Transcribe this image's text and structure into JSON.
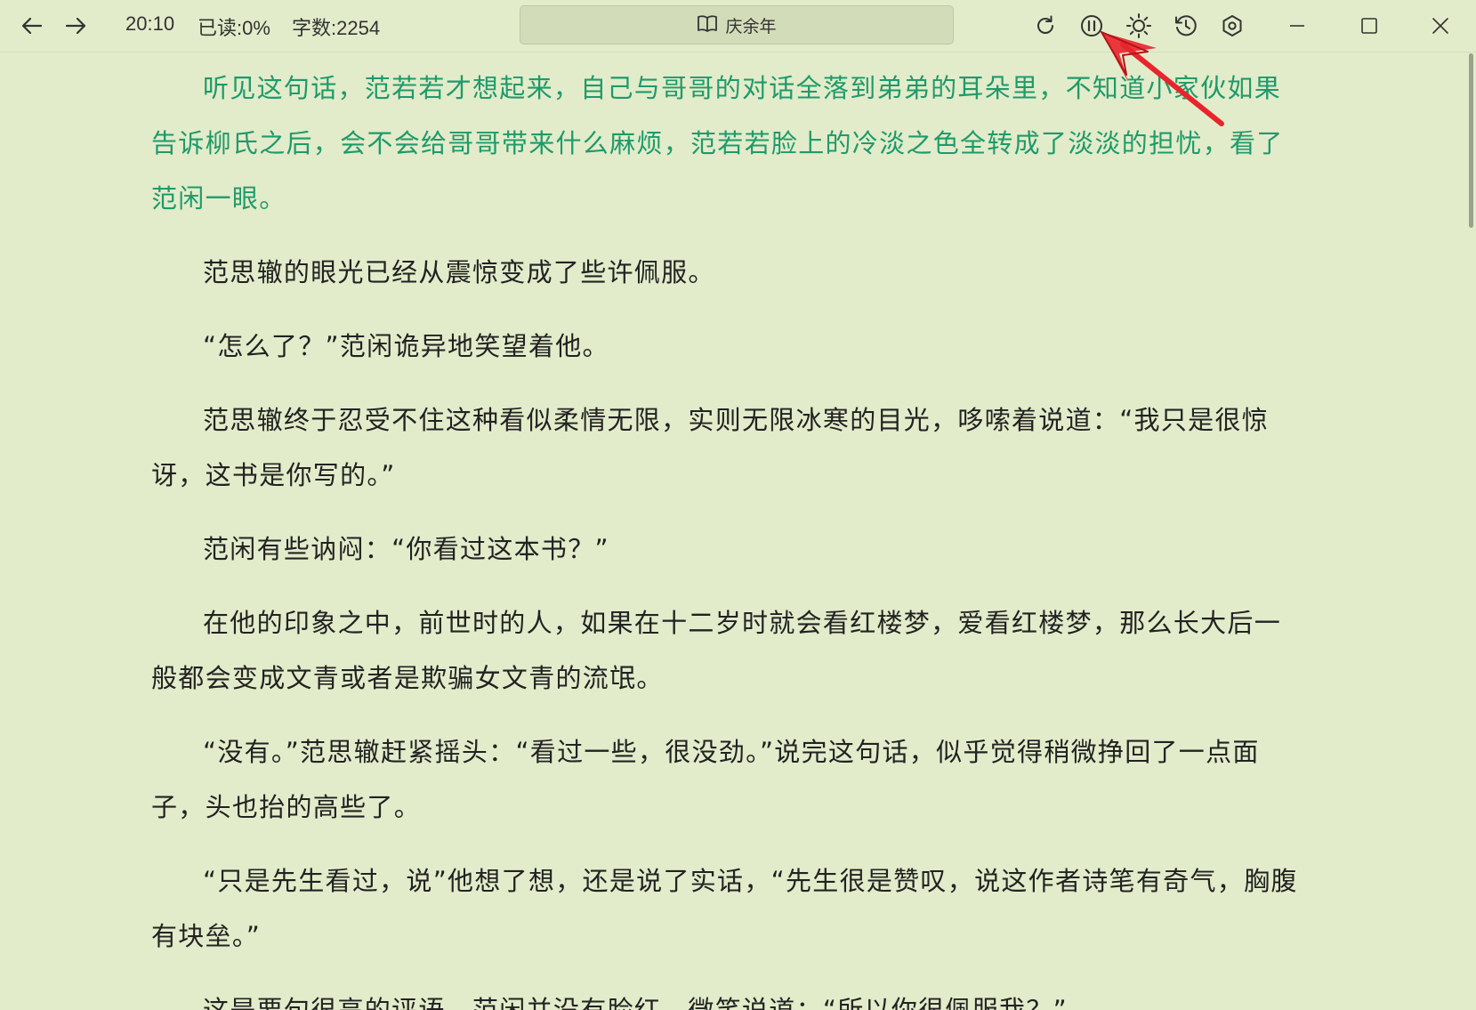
{
  "app": {
    "back_icon": "arrow-left-icon",
    "forward_icon": "arrow-right-icon",
    "status": {
      "time": "20:10",
      "read_progress": "已读:0%",
      "word_count": "字数:2254"
    },
    "book": {
      "icon": "open-book-icon",
      "title": "庆余年"
    },
    "toolbar": [
      "refresh-icon",
      "pause-icon",
      "brightness-icon",
      "history-icon",
      "settings-icon"
    ],
    "window_controls": [
      "minimize-icon",
      "maximize-icon",
      "close-icon"
    ],
    "highlight_color": "#1f9a6a",
    "background_color": "#e3ecca",
    "annotation_color": "#e8252c"
  },
  "reader": {
    "paragraphs": [
      "听见这句话，范若若才想起来，自己与哥哥的对话全落到弟弟的耳朵里，不知道小家伙如果告诉柳氏之后，会不会给哥哥带来什么麻烦，范若若脸上的冷淡之色全转成了淡淡的担忧，看了范闲一眼。",
      "范思辙的眼光已经从震惊变成了些许佩服。",
      "“怎么了？”范闲诡异地笑望着他。",
      "范思辙终于忍受不住这种看似柔情无限，实则无限冰寒的目光，哆嗦着说道：“我只是很惊讶，这书是你写的。”",
      "范闲有些讷闷：“你看过这本书？”",
      "在他的印象之中，前世时的人，如果在十二岁时就会看红楼梦，爱看红楼梦，那么长大后一般都会变成文青或者是欺骗女文青的流氓。",
      "“没有。”范思辙赶紧摇头：“看过一些，很没劲。”说完这句话，似乎觉得稍微挣回了一点面子，头也抬的高些了。",
      "“只是先生看过，说”他想了想，还是说了实话，“先生很是赞叹，说这作者诗笔有奇气，胸腹有块垒。”",
      "这是要句很高的评语，范闲并没有脸红，微笑说道：“所以你很佩服我？”"
    ]
  }
}
